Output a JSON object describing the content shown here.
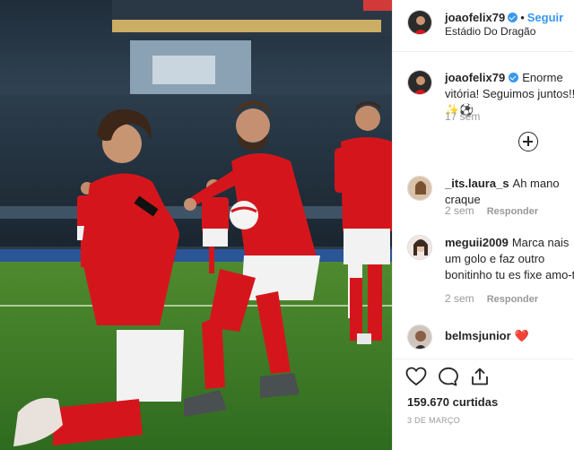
{
  "post": {
    "username": "joaofelix79",
    "follow_label": "Seguir",
    "location": "Estádio Do Dragão"
  },
  "caption": {
    "username": "joaofelix79",
    "text": "Enorme vitória! Seguimos juntos!! ✨⚽",
    "time": "17 sem"
  },
  "comments": [
    {
      "username": "_its.laura_s",
      "text": "Ah mano craque",
      "time": "2 sem",
      "reply_label": "Responder"
    },
    {
      "username": "meguii2009",
      "text": "Marca nais um golo e faz outro bonitinho tu es fixe amo-te",
      "time": "2 sem",
      "reply_label": "Responder"
    },
    {
      "username": "belmsjunior",
      "text": "❤️"
    }
  ],
  "stats": {
    "likes": "159.670 curtidas",
    "date": "3 DE MARÇO"
  },
  "icons": [
    "heart-icon",
    "comment-icon",
    "share-icon",
    "plus-circle-icon",
    "verified-badge-icon"
  ],
  "colors": {
    "link": "#3897f0",
    "text": "#262626",
    "muted": "#999999",
    "jersey_red": "#d4161c"
  }
}
